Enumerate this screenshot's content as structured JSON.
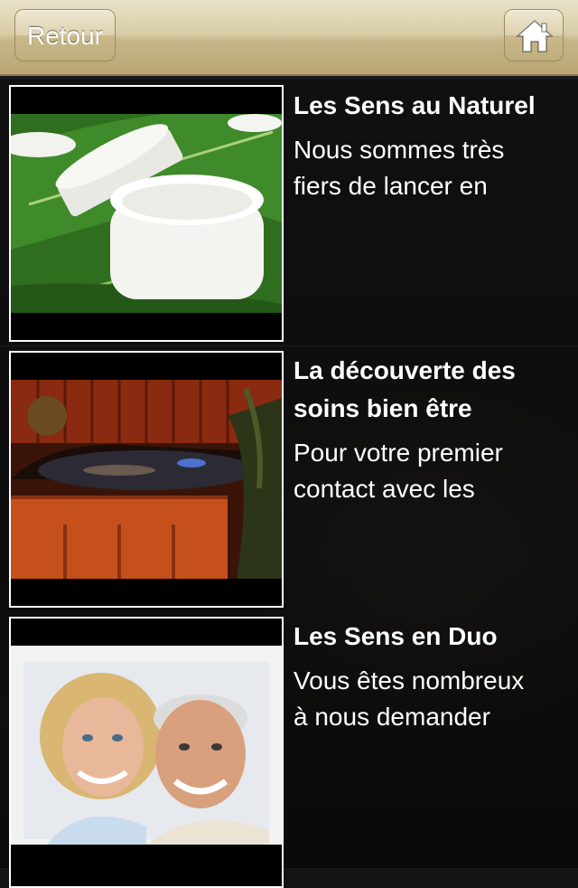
{
  "header": {
    "back_label": "Retour",
    "home_icon": "home-icon"
  },
  "articles": [
    {
      "title": "Les Sens au Naturel",
      "excerpt_line1": "Nous sommes très",
      "excerpt_line2": "fiers de lancer en"
    },
    {
      "title_line1": "La découverte des",
      "title_line2": "soins bien être",
      "excerpt_line1": "Pour votre premier",
      "excerpt_line2": "contact avec les"
    },
    {
      "title": "Les Sens en Duo",
      "excerpt_line1": "Vous êtes nombreux",
      "excerpt_line2": "à nous demander"
    }
  ],
  "colors": {
    "header_gold": "#c6b68a",
    "background": "#141414",
    "text": "#ffffff"
  }
}
